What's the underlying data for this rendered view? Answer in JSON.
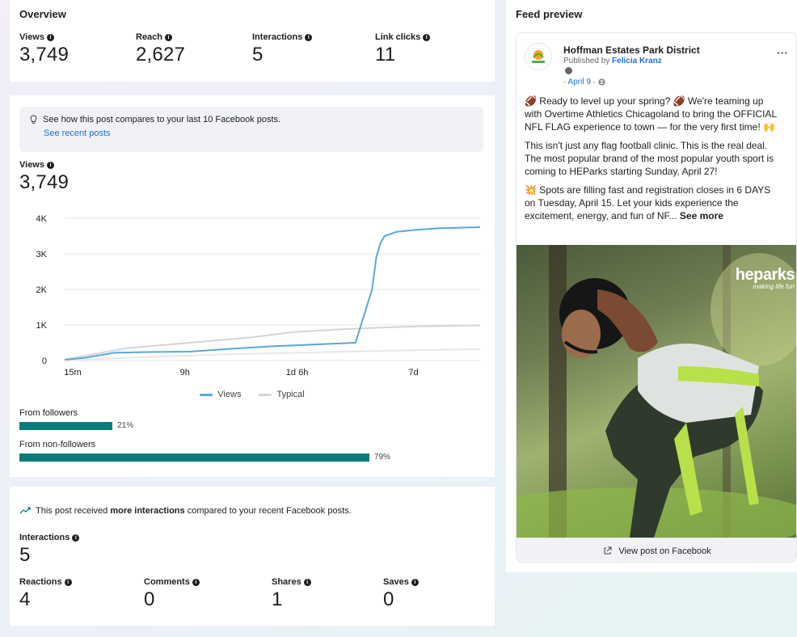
{
  "overview": {
    "title": "Overview",
    "metrics": [
      {
        "label": "Views",
        "value": "3,749"
      },
      {
        "label": "Reach",
        "value": "2,627"
      },
      {
        "label": "Interactions",
        "value": "5"
      },
      {
        "label": "Link clicks",
        "value": "11"
      }
    ]
  },
  "compare": {
    "tip_text": "See how this post compares to your last 10 Facebook posts.",
    "tip_link": "See recent posts",
    "views_label": "Views",
    "views_value": "3,749",
    "legend_views": "Views",
    "legend_typical": "Typical",
    "followers_label": "From followers",
    "followers_pct": "21%",
    "nonfollowers_label": "From non-followers",
    "nonfollowers_pct": "79%"
  },
  "chart_data": {
    "type": "line",
    "title": "",
    "x_tick_labels": [
      "15m",
      "9h",
      "1d 6h",
      "7d"
    ],
    "y_ticks": [
      "0",
      "1K",
      "2K",
      "3K",
      "4K"
    ],
    "ylim": [
      0,
      4000
    ],
    "grid": true,
    "legend_placement": "bottom",
    "series": [
      {
        "name": "Views",
        "color": "#5aa7d9",
        "x": [
          0,
          0.05,
          0.12,
          0.2,
          0.3,
          0.4,
          0.5,
          0.58,
          0.66,
          0.7,
          0.74,
          0.75,
          0.76,
          0.77,
          0.8,
          0.85,
          0.9,
          1.0
        ],
        "values": [
          20,
          80,
          220,
          240,
          250,
          330,
          400,
          440,
          480,
          500,
          2000,
          2900,
          3300,
          3500,
          3620,
          3680,
          3720,
          3749
        ]
      },
      {
        "name": "Typical",
        "color": "#d5d5d8",
        "x": [
          0,
          0.08,
          0.15,
          0.25,
          0.35,
          0.45,
          0.55,
          0.65,
          0.75,
          0.85,
          1.0
        ],
        "values": [
          30,
          200,
          350,
          450,
          550,
          650,
          800,
          870,
          920,
          960,
          990
        ]
      },
      {
        "name": "",
        "color": "#e7e7ea",
        "x": [
          0,
          0.2,
          0.4,
          0.6,
          0.8,
          1.0
        ],
        "values": [
          10,
          100,
          180,
          230,
          280,
          320
        ]
      }
    ]
  },
  "followers_fraction": 0.21,
  "nonfollowers_fraction": 0.79,
  "interactions": {
    "note_prefix": "This post received ",
    "note_bold": "more interactions",
    "note_suffix": " compared to your recent Facebook posts.",
    "interactions_label": "Interactions",
    "interactions_value": "5",
    "metrics": [
      {
        "label": "Reactions",
        "value": "4"
      },
      {
        "label": "Comments",
        "value": "0"
      },
      {
        "label": "Shares",
        "value": "1"
      },
      {
        "label": "Saves",
        "value": "0"
      }
    ]
  },
  "feed": {
    "title": "Feed preview",
    "page_name": "Hoffman Estates Park District",
    "published_by_prefix": "Published by ",
    "published_by_name": "Felicia Kranz",
    "date": "· April 9 ·",
    "more": "···",
    "p1": "🏈 Ready to level up your spring? 🏈 We're teaming up with Overtime Athletics Chicagoland to bring the OFFICIAL NFL FLAG experience to town — for the very first time! 🙌",
    "p2": "This isn't just any flag football clinic. This is the real deal. The most popular brand of the most popular youth sport is coming to HEParks starting Sunday, April 27!",
    "p3": "💥 Spots are filling fast and registration closes in 6 DAYS on Tuesday, April 15. Let your kids experience the excitement, energy, and fun of NF...",
    "see_more": "See more",
    "logo_text": "heparks",
    "logo_tagline": "making life fun",
    "view_post": "View post on Facebook"
  },
  "colors": {
    "accent_link": "#216fdb",
    "bar_teal": "#0a7d7a",
    "views_line": "#5aa7d9"
  }
}
